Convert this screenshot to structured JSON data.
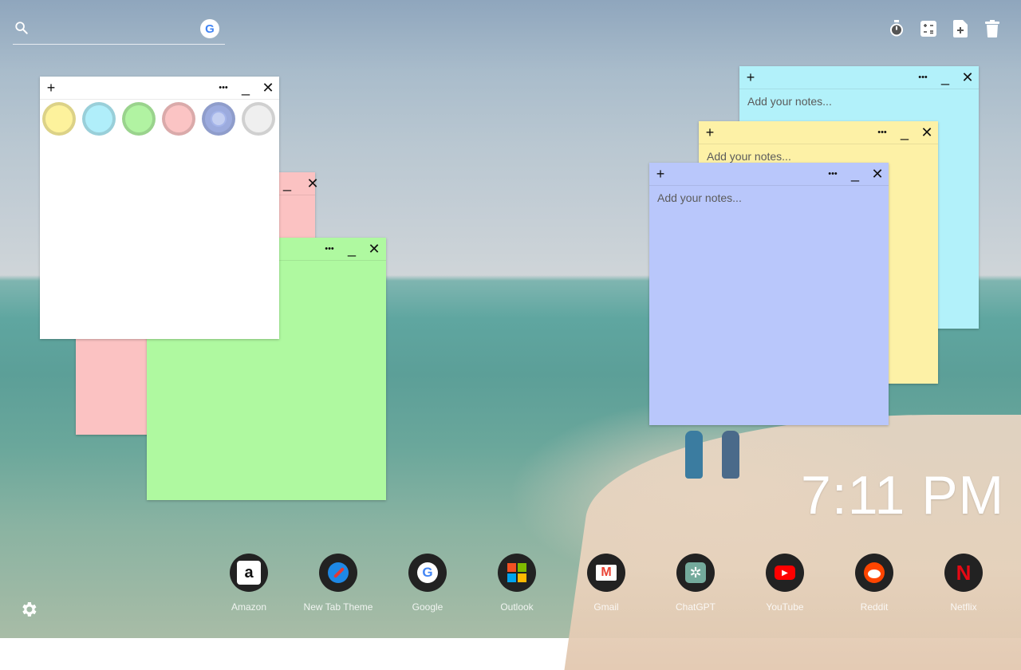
{
  "search": {
    "placeholder": "",
    "engine_icon": "google-g-icon",
    "engine_letter": "G"
  },
  "toolbar": {
    "icons": [
      "stopwatch-icon",
      "calculator-icon",
      "add-note-icon",
      "trash-icon"
    ]
  },
  "notes": [
    {
      "id": "white",
      "color": "#ffffff",
      "placeholder": "",
      "show_swatches": true
    },
    {
      "id": "pink",
      "color": "#fbc2c2",
      "placeholder": ""
    },
    {
      "id": "green",
      "color": "#aff9a0",
      "placeholder": ""
    },
    {
      "id": "cyan",
      "color": "#b2f1fa",
      "placeholder": "Add your notes..."
    },
    {
      "id": "yellow",
      "color": "#fdf1a6",
      "placeholder": "Add your notes..."
    },
    {
      "id": "blue",
      "color": "#b9c7fb",
      "placeholder": "Add your notes..."
    }
  ],
  "note_controls": {
    "add": "+",
    "more": "•••",
    "minimize": "_",
    "close": "✕"
  },
  "swatch_colors": [
    "#fdf29c",
    "#b0eefa",
    "#b1f3a2",
    "#fbc4c4",
    "#a5b5ea",
    "#efefef"
  ],
  "clock": {
    "time": "7:11 PM"
  },
  "dock": [
    {
      "label": "Amazon",
      "icon": "amazon-icon",
      "glyph": "a"
    },
    {
      "label": "New Tab Theme",
      "icon": "new-tab-theme-icon",
      "glyph": ""
    },
    {
      "label": "Google",
      "icon": "google-icon",
      "glyph": "G"
    },
    {
      "label": "Outlook",
      "icon": "outlook-icon",
      "glyph": ""
    },
    {
      "label": "Gmail",
      "icon": "gmail-icon",
      "glyph": "M"
    },
    {
      "label": "ChatGPT",
      "icon": "chatgpt-icon",
      "glyph": "✲"
    },
    {
      "label": "YouTube",
      "icon": "youtube-icon",
      "glyph": "▶"
    },
    {
      "label": "Reddit",
      "icon": "reddit-icon",
      "glyph": ""
    },
    {
      "label": "Netflix",
      "icon": "netflix-icon",
      "glyph": "N"
    }
  ],
  "settings": {
    "icon": "gear-icon"
  }
}
